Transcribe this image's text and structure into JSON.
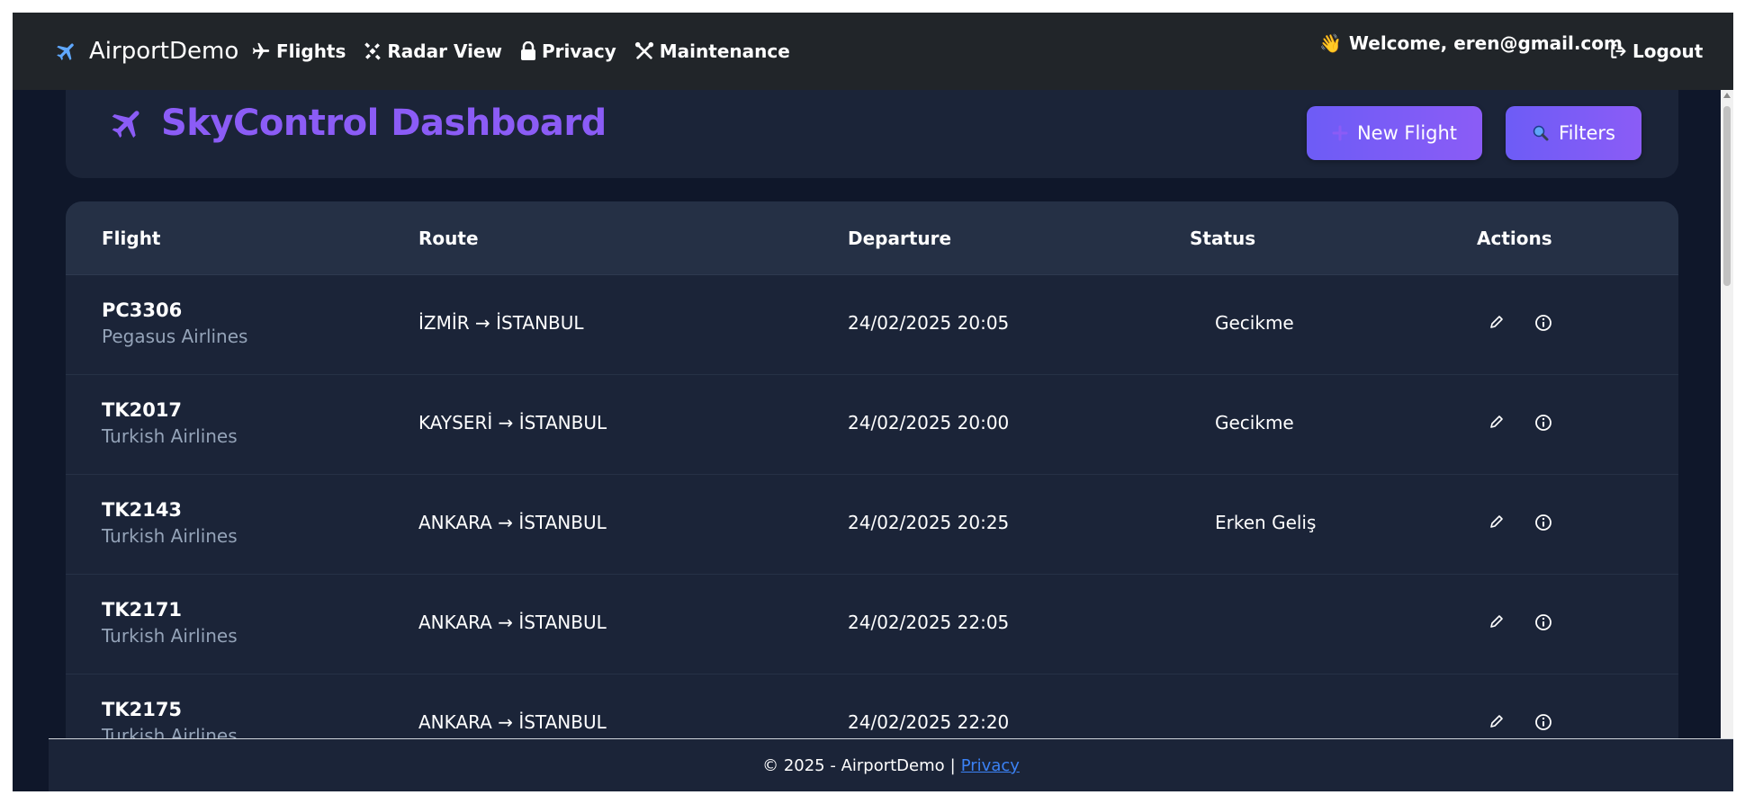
{
  "navbar": {
    "brand": "AirportDemo",
    "links": [
      {
        "label": "Flights",
        "icon": "plane-icon"
      },
      {
        "label": "Radar View",
        "icon": "satellite-icon"
      },
      {
        "label": "Privacy",
        "icon": "lock-icon"
      },
      {
        "label": "Maintenance",
        "icon": "tools-icon"
      }
    ],
    "welcome": "Welcome, eren@gmail.com",
    "welcome_emoji": "👋",
    "logout": "Logout"
  },
  "header": {
    "title": "SkyControl Dashboard",
    "new_flight": "New Flight",
    "filters": "Filters"
  },
  "table": {
    "columns": [
      "Flight",
      "Route",
      "Departure",
      "Status",
      "Actions"
    ],
    "rows": [
      {
        "code": "PC3306",
        "airline": "Pegasus Airlines",
        "route": "İZMİR → İSTANBUL",
        "departure": "24/02/2025 20:05",
        "status": "Gecikme"
      },
      {
        "code": "TK2017",
        "airline": "Turkish Airlines",
        "route": "KAYSERİ → İSTANBUL",
        "departure": "24/02/2025 20:00",
        "status": "Gecikme"
      },
      {
        "code": "TK2143",
        "airline": "Turkish Airlines",
        "route": "ANKARA → İSTANBUL",
        "departure": "24/02/2025 20:25",
        "status": "Erken Geliş"
      },
      {
        "code": "TK2171",
        "airline": "Turkish Airlines",
        "route": "ANKARA → İSTANBUL",
        "departure": "24/02/2025 22:05",
        "status": ""
      },
      {
        "code": "TK2175",
        "airline": "Turkish Airlines",
        "route": "ANKARA → İSTANBUL",
        "departure": "24/02/2025 22:20",
        "status": ""
      }
    ]
  },
  "footer": {
    "copyright": "© 2025 - AirportDemo",
    "separator": "|",
    "privacy_link": "Privacy"
  },
  "colors": {
    "accent": "#8b5cf6",
    "background": "#0f172a",
    "card": "#1b2438",
    "navbar": "#212529"
  }
}
